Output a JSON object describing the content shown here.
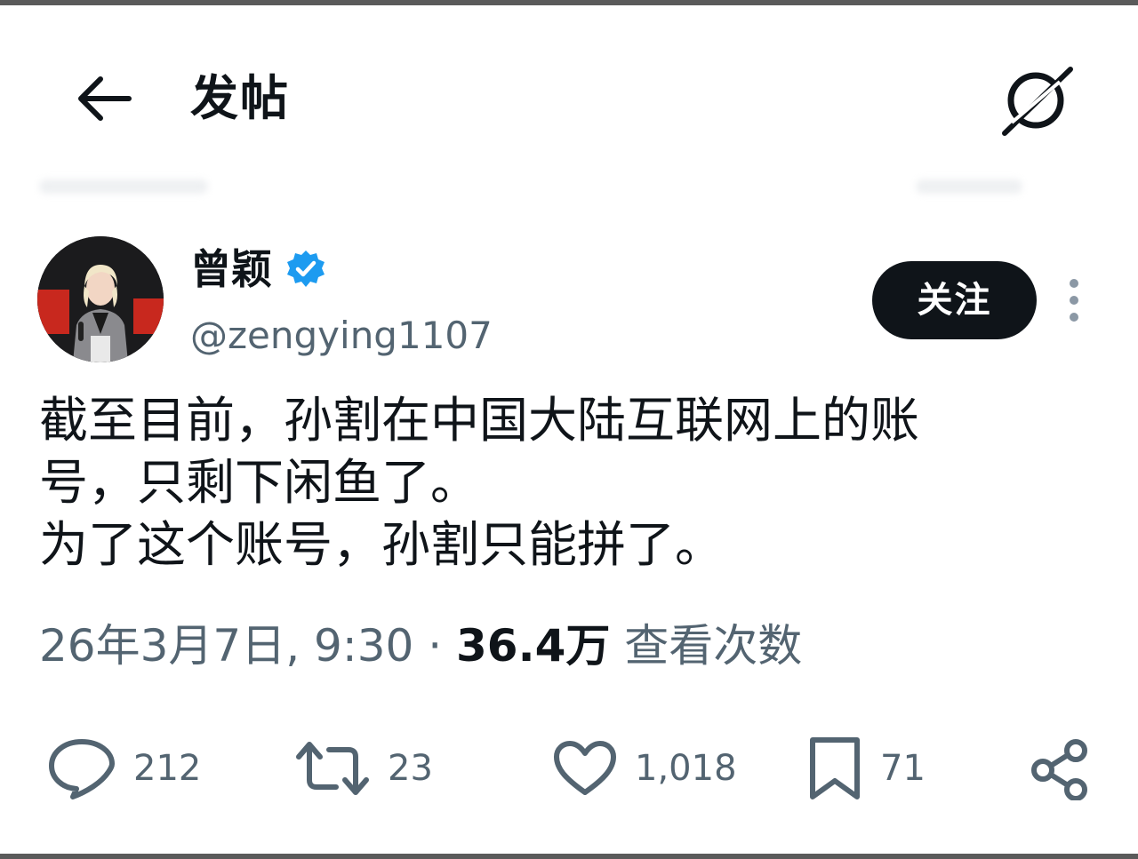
{
  "header": {
    "title": "发帖",
    "back_icon": "arrow-left-icon",
    "grok_icon": "grok-icon"
  },
  "author": {
    "name": "曾颖",
    "handle": "@zengying1107",
    "verified_icon": "verified-badge-icon",
    "verified_color": "#1d9bf0",
    "follow_label": "关注"
  },
  "tweet": {
    "lines": [
      "截至目前，孙割在中国大陆互联网上的账",
      "号，只剩下闲鱼了。",
      "为了这个账号，孙割只能拼了。"
    ]
  },
  "meta": {
    "timestamp": "26年3月7日, 9:30",
    "separator": " · ",
    "views_count": "36.4万",
    "views_label": " 查看次数"
  },
  "actions": {
    "reply": {
      "icon": "reply-icon",
      "count": "212"
    },
    "repost": {
      "icon": "repost-icon",
      "count": "23"
    },
    "like": {
      "icon": "heart-icon",
      "count": "1,018"
    },
    "bookmark": {
      "icon": "bookmark-icon",
      "count": "71"
    },
    "share": {
      "icon": "share-icon"
    }
  },
  "colors": {
    "text": "#0f1419",
    "secondary": "#536471",
    "accent": "#1d9bf0"
  }
}
